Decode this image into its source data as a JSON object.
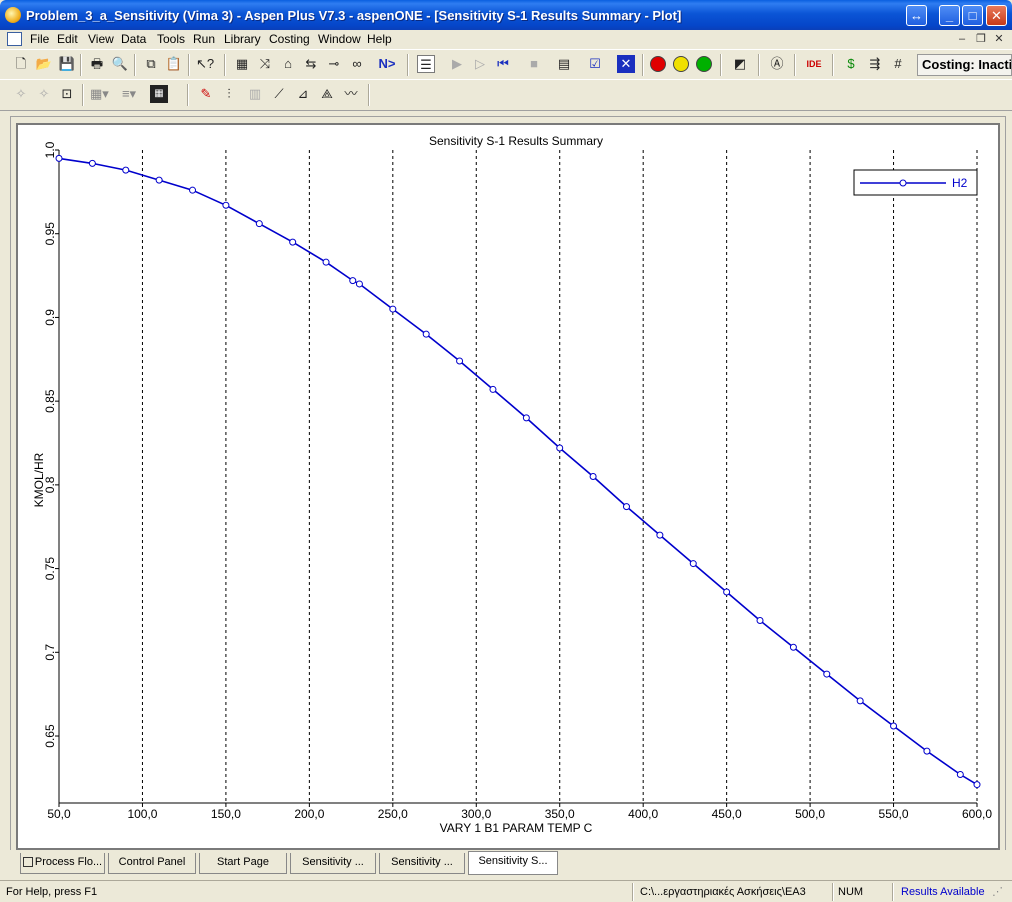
{
  "window": {
    "title": "Problem_3_a_Sensitivity (Vima 3) - Aspen Plus V7.3 - aspenONE - [Sensitivity S-1 Results Summary - Plot]",
    "resize_glyph": "↔",
    "minimize_glyph": "_",
    "maximize_glyph": "□",
    "close_glyph": "✕"
  },
  "menu": {
    "items": [
      "File",
      "Edit",
      "View",
      "Data",
      "Tools",
      "Run",
      "Library",
      "Costing",
      "Window",
      "Help"
    ],
    "mdi_minimize": "–",
    "mdi_restore": "❐",
    "mdi_close": "✕"
  },
  "toolbar": {
    "next_label": "N>",
    "costing_status": "Costing: Inactive",
    "accent_red": "#e00000",
    "accent_yellow": "#f0e000",
    "accent_green": "#00b000"
  },
  "chart_data": {
    "type": "line",
    "title": "Sensitivity S-1 Results Summary",
    "xlabel": "VARY   1 B1 PARAM TEMP  C",
    "ylabel": "KMOL/HR",
    "xlim": [
      50,
      600
    ],
    "ylim": [
      0.61,
      1.0
    ],
    "x_ticks": [
      "50,0",
      "100,0",
      "150,0",
      "200,0",
      "250,0",
      "300,0",
      "350,0",
      "400,0",
      "450,0",
      "500,0",
      "550,0",
      "600,0"
    ],
    "y_ticks": [
      "0.65",
      "0.7",
      "0.75",
      "0.8",
      "0.85",
      "0.9",
      "0.95",
      "1.0"
    ],
    "legend_position": "top-right",
    "grid": "vertical dashed",
    "series_color": "#0000cc",
    "series": [
      {
        "name": "H2",
        "x": [
          50,
          70,
          90,
          110,
          130,
          150,
          170,
          190,
          210,
          226,
          230,
          250,
          270,
          290,
          310,
          330,
          350,
          370,
          390,
          410,
          430,
          450,
          470,
          490,
          510,
          530,
          550,
          570,
          590,
          600
        ],
        "y": [
          0.995,
          0.992,
          0.988,
          0.982,
          0.976,
          0.967,
          0.956,
          0.945,
          0.933,
          0.922,
          0.92,
          0.905,
          0.89,
          0.874,
          0.857,
          0.84,
          0.822,
          0.805,
          0.787,
          0.77,
          0.753,
          0.736,
          0.719,
          0.703,
          0.687,
          0.671,
          0.656,
          0.641,
          0.627,
          0.621
        ]
      }
    ]
  },
  "tabs": [
    {
      "label": "Process Flo..."
    },
    {
      "label": "Control Panel"
    },
    {
      "label": "Start Page"
    },
    {
      "label": "Sensitivity ..."
    },
    {
      "label": "Sensitivity ..."
    },
    {
      "label": "Sensitivity S..."
    }
  ],
  "status": {
    "help": "For Help, press F1",
    "path": "C:\\...εργαστηριακές Ασκήσεις\\EA3",
    "num": "NUM",
    "results": "Results Available",
    "results_color": "#0000cc"
  }
}
